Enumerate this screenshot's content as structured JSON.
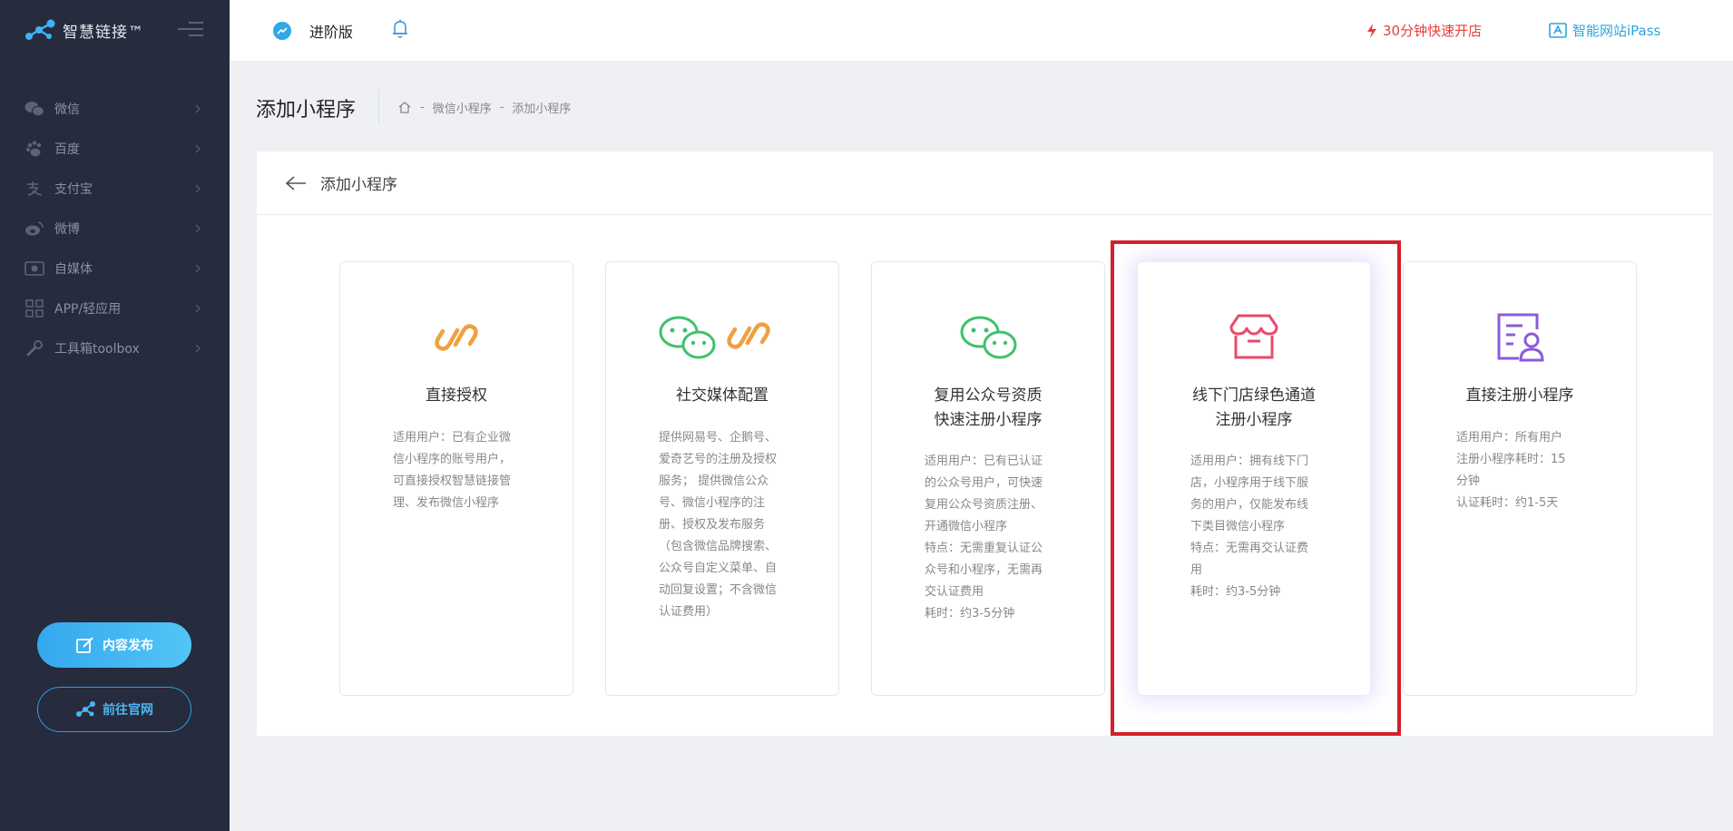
{
  "brand": {
    "name": "智慧链接™"
  },
  "sidebar": {
    "items": [
      {
        "label": "微信",
        "icon": "wechat-icon"
      },
      {
        "label": "百度",
        "icon": "paw-icon"
      },
      {
        "label": "支付宝",
        "icon": "alipay-icon"
      },
      {
        "label": "微博",
        "icon": "weibo-icon"
      },
      {
        "label": "自媒体",
        "icon": "media-icon"
      },
      {
        "label": "APP/轻应用",
        "icon": "app-grid-icon"
      },
      {
        "label": "工具箱toolbox",
        "icon": "wrench-icon"
      }
    ],
    "publish_label": "内容发布",
    "site_label": "前往官网"
  },
  "header": {
    "edition": "进阶版",
    "quick_open": "30分钟快速开店",
    "ipass": "智能网站iPass"
  },
  "page": {
    "title": "添加小程序",
    "breadcrumb": [
      "微信小程序",
      "添加小程序"
    ]
  },
  "panel": {
    "title": "添加小程序",
    "cards": [
      {
        "title": "直接授权",
        "icon": "link-icon",
        "desc": [
          "适用用户：已有企业微",
          "信小程序的账号用户，",
          "可直接授权智慧链接管",
          "理、发布微信小程序"
        ]
      },
      {
        "title": "社交媒体配置",
        "icon": "wechat-link-icon",
        "desc": [
          "提供网易号、企鹅号、",
          "爱奇艺号的注册及授权",
          "服务； 提供微信公众",
          "号、微信小程序的注",
          "册、授权及发布服务",
          "（包含微信品牌搜索、",
          "公众号自定义菜单、自",
          "动回复设置；不含微信",
          "认证费用）"
        ]
      },
      {
        "title_lines": [
          "复用公众号资质",
          "快速注册小程序"
        ],
        "icon": "wechat-icon",
        "desc": [
          "适用用户：已有已认证",
          "的公众号用户，可快速",
          "复用公众号资质注册、",
          "开通微信小程序",
          "特点：无需重复认证公",
          "众号和小程序，无需再",
          "交认证费用",
          "耗时：约3-5分钟"
        ]
      },
      {
        "title_lines": [
          "线下门店绿色通道",
          "注册小程序"
        ],
        "icon": "store-icon",
        "desc": [
          "适用用户：拥有线下门",
          "店，小程序用于线下服",
          "务的用户，仅能发布线",
          "下类目微信小程序",
          "特点：无需再交认证费",
          "用",
          "耗时：约3-5分钟"
        ]
      },
      {
        "title": "直接注册小程序",
        "icon": "register-icon",
        "desc": [
          "适用用户：所有用户",
          "注册小程序耗时：15",
          "分钟",
          "认证耗时：约1-5天"
        ]
      }
    ]
  },
  "colors": {
    "sidebar_bg": "#262b3e",
    "accent_blue": "#35a8ee",
    "link_orange": "#f0a040",
    "wechat_green": "#3ec26b",
    "store_pink": "#e94b6b",
    "register_purple": "#8b5bd8",
    "highlight_red": "#d4202a"
  }
}
